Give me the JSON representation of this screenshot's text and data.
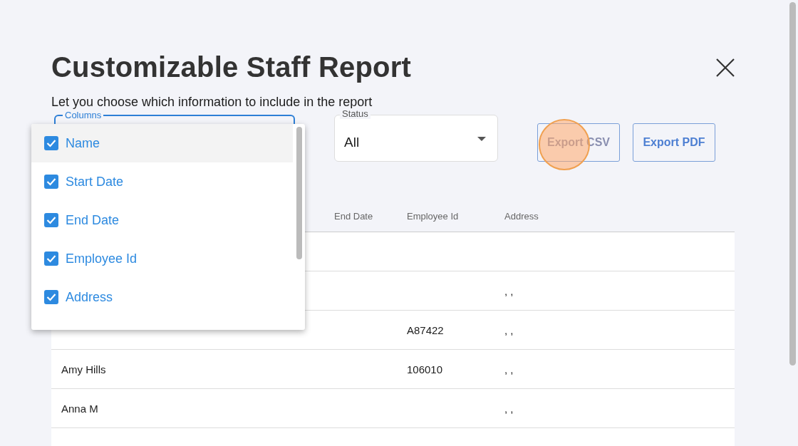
{
  "dialog": {
    "title": "Customizable Staff Report",
    "subtitle": "Let you choose which information to include in the report"
  },
  "columns_field": {
    "label": "Columns"
  },
  "status_field": {
    "label": "Status",
    "value": "All"
  },
  "buttons": [
    {
      "label": "Export CSV",
      "pressed": true
    },
    {
      "label": "Export PDF",
      "pressed": false
    }
  ],
  "table": {
    "columns": [
      null,
      null,
      "End Date",
      "Employee Id",
      "Address"
    ],
    "rows": [
      {
        "cells": [
          null,
          null,
          null,
          null,
          null
        ]
      },
      {
        "cells": [
          null,
          null,
          null,
          null,
          ", ,"
        ]
      },
      {
        "cells": [
          null,
          null,
          null,
          "A87422",
          ", ,"
        ]
      },
      {
        "cells": [
          "Amy Hills",
          null,
          null,
          "106010",
          ", ,"
        ]
      },
      {
        "cells": [
          "Anna M",
          null,
          null,
          null,
          ", ,"
        ]
      },
      {
        "cells": [
          null,
          null,
          null,
          null,
          null
        ]
      }
    ]
  },
  "column_menu": [
    {
      "label": "Name",
      "checked": true,
      "highlighted": true
    },
    {
      "label": "Start Date",
      "checked": true,
      "highlighted": false
    },
    {
      "label": "End Date",
      "checked": true,
      "highlighted": false
    },
    {
      "label": "Employee Id",
      "checked": true,
      "highlighted": false
    },
    {
      "label": "Address",
      "checked": true,
      "highlighted": false
    }
  ]
}
